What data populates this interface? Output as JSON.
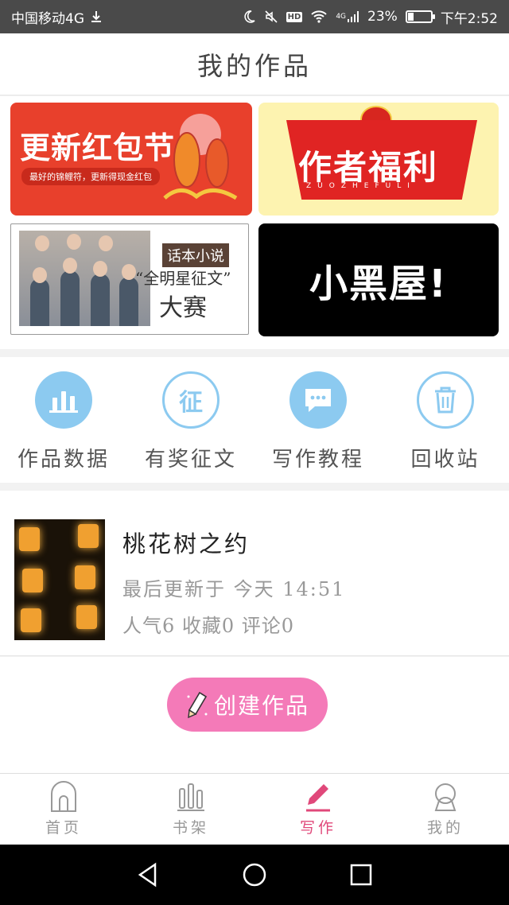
{
  "status_bar": {
    "carrier": "中国移动4G",
    "hd": "HD",
    "network": "4G",
    "battery": "23%",
    "battery_level": 0.23,
    "time": "下午2:52"
  },
  "header": {
    "title": "我的作品"
  },
  "banners": {
    "b1": {
      "title": "更新红包节",
      "subtitle": "最好的锦鲤符，更新得现金红包"
    },
    "b2": {
      "title": "作者福利",
      "subtitle": "ZUOZHEFULI"
    },
    "b3": {
      "tag": "话本小说",
      "line1": "“全明星征文”",
      "line2": "大赛"
    },
    "b4": {
      "title": "小黑屋!"
    }
  },
  "actions": [
    {
      "label": "作品数据",
      "icon": "bar-chart-icon"
    },
    {
      "label": "有奖征文",
      "icon": "zheng-icon",
      "glyph": "征"
    },
    {
      "label": "写作教程",
      "icon": "chat-bubble-icon"
    },
    {
      "label": "回收站",
      "icon": "trash-icon"
    }
  ],
  "work": {
    "title": "桃花树之约",
    "updated": "最后更新于 今天 14:51",
    "stats": "人气6 收藏0 评论0"
  },
  "create_button": {
    "label": "创建作品"
  },
  "tabs": [
    {
      "label": "首页",
      "icon": "home-icon"
    },
    {
      "label": "书架",
      "icon": "bookshelf-icon"
    },
    {
      "label": "写作",
      "icon": "pencil-icon",
      "active": true
    },
    {
      "label": "我的",
      "icon": "profile-icon"
    }
  ],
  "colors": {
    "accent": "#e0487a",
    "button": "#f47ab8",
    "action_blue": "#8ccaf0"
  }
}
